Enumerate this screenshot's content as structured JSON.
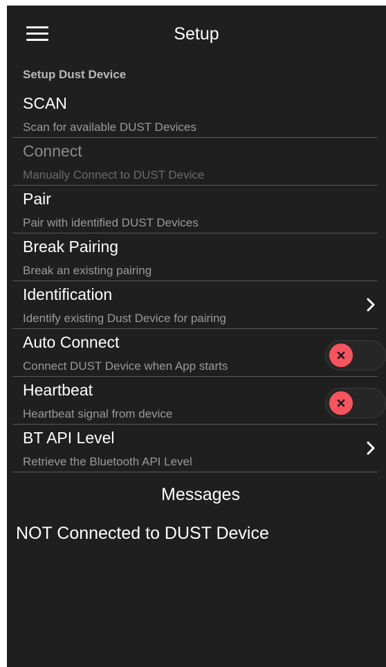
{
  "topbar": {
    "title": "Setup",
    "menu_icon": "hamburger-menu-icon"
  },
  "section": {
    "header": "Setup Dust Device"
  },
  "prefs": [
    {
      "title": "SCAN",
      "summary": "Scan for available DUST Devices",
      "enabled": true,
      "widget": "none"
    },
    {
      "title": "Connect",
      "summary": "Manually Connect to DUST Device",
      "enabled": false,
      "widget": "none"
    },
    {
      "title": "Pair",
      "summary": "Pair with identified DUST Devices",
      "enabled": true,
      "widget": "none"
    },
    {
      "title": "Break Pairing",
      "summary": "Break an existing pairing",
      "enabled": true,
      "widget": "none"
    },
    {
      "title": "Identification",
      "summary": "Identify existing Dust Device for pairing",
      "enabled": true,
      "widget": "chevron-right-icon"
    },
    {
      "title": "Auto Connect",
      "summary": "Connect DUST Device when App starts",
      "enabled": true,
      "widget": "switch",
      "checked": false
    },
    {
      "title": "Heartbeat",
      "summary": "Heartbeat signal from device",
      "enabled": true,
      "widget": "switch",
      "checked": false
    },
    {
      "title": "BT API Level",
      "summary": "Retrieve the Bluetooth API Level",
      "enabled": true,
      "widget": "chevron-right-icon"
    }
  ],
  "messages": {
    "title": "Messages",
    "status": "NOT Connected to DUST Device"
  },
  "colors": {
    "background": "#1f1f1f",
    "divider": "#5a5a5a",
    "switch_off_thumb": "#f7545f",
    "text_primary": "#ffffff",
    "text_secondary": "#9a9a9a"
  }
}
